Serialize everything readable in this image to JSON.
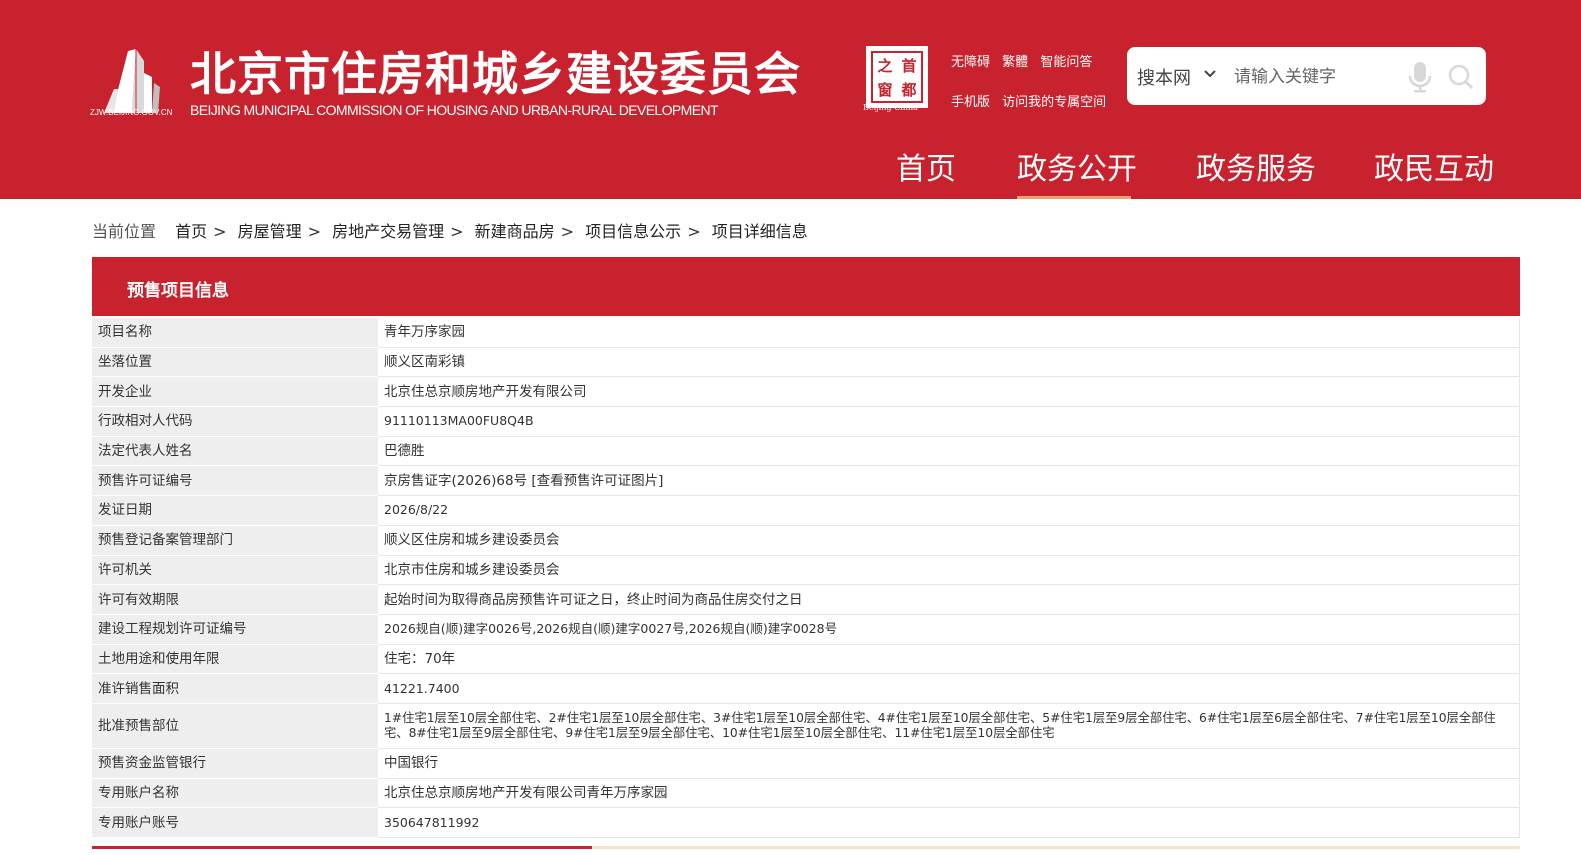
{
  "header": {
    "logo_domain": "ZJW.BEIJING.GOV.CN",
    "title": "北京市住房和城乡建设委员会",
    "subtitle": "BEIJING MUNICIPAL COMMISSION OF HOUSING AND URBAN-RURAL DEVELOPMENT",
    "seal_chars": [
      "之",
      "首",
      "窗",
      "都"
    ],
    "seal_caption": "Beijing-China",
    "top_links_row1": [
      "无障碍",
      "繁體",
      "智能问答"
    ],
    "top_links_row2": [
      "手机版",
      "访问我的专属空间"
    ],
    "search": {
      "scope": "搜本网",
      "placeholder": "请输入关键字"
    },
    "nav": [
      "首页",
      "政务公开",
      "政务服务",
      "政民互动"
    ],
    "active_nav": "政务公开"
  },
  "breadcrumb": {
    "current_label": "当前位置",
    "items": [
      "首页",
      "房屋管理",
      "房地产交易管理",
      "新建商品房",
      "项目信息公示",
      "项目详细信息"
    ]
  },
  "panel": {
    "title": "预售项目信息",
    "rows": [
      {
        "label": "项目名称",
        "value": "青年万序家园"
      },
      {
        "label": "坐落位置",
        "value": "顺义区南彩镇"
      },
      {
        "label": "开发企业",
        "value": "北京住总京顺房地产开发有限公司"
      },
      {
        "label": "行政相对人代码",
        "value": "91110113MA00FU8Q4B"
      },
      {
        "label": "法定代表人姓名",
        "value": "巴德胜"
      },
      {
        "label": "预售许可证编号",
        "value": "京房售证字(2026)68号",
        "link": "[查看预售许可证图片]"
      },
      {
        "label": "发证日期",
        "value": "2026/8/22"
      },
      {
        "label": "预售登记备案管理部门",
        "value": "顺义区住房和城乡建设委员会"
      },
      {
        "label": "许可机关",
        "value": "北京市住房和城乡建设委员会"
      },
      {
        "label": "许可有效期限",
        "value": "起始时间为取得商品房预售许可证之日，终止时间为商品住房交付之日"
      },
      {
        "label": "建设工程规划许可证编号",
        "value": "2026规自(顺)建字0026号,2026规自(顺)建字0027号,2026规自(顺)建字0028号"
      },
      {
        "label": "土地用途和使用年限",
        "value": "住宅：70年"
      },
      {
        "label": "准许销售面积",
        "value": "41221.7400"
      },
      {
        "label": "批准预售部位",
        "value": "1#住宅1层至10层全部住宅、2#住宅1层至10层全部住宅、3#住宅1层至10层全部住宅、4#住宅1层至10层全部住宅、5#住宅1层至9层全部住宅、6#住宅1层至6层全部住宅、7#住宅1层至10层全部住宅、8#住宅1层至9层全部住宅、9#住宅1层至9层全部住宅、10#住宅1层至10层全部住宅、11#住宅1层至10层全部住宅"
      },
      {
        "label": "预售资金监管银行",
        "value": "中国银行"
      },
      {
        "label": "专用账户名称",
        "value": "北京住总京顺房地产开发有限公司青年万序家园"
      },
      {
        "label": "专用账户账号",
        "value": "350647811992"
      }
    ]
  },
  "colors": {
    "brand_red": "#c8222e",
    "nav_underline": "#e8a26b",
    "label_bg": "#eeeeee"
  },
  "icons": [
    "logo-building-icon",
    "chevron-down-icon",
    "microphone-icon",
    "search-icon"
  ]
}
